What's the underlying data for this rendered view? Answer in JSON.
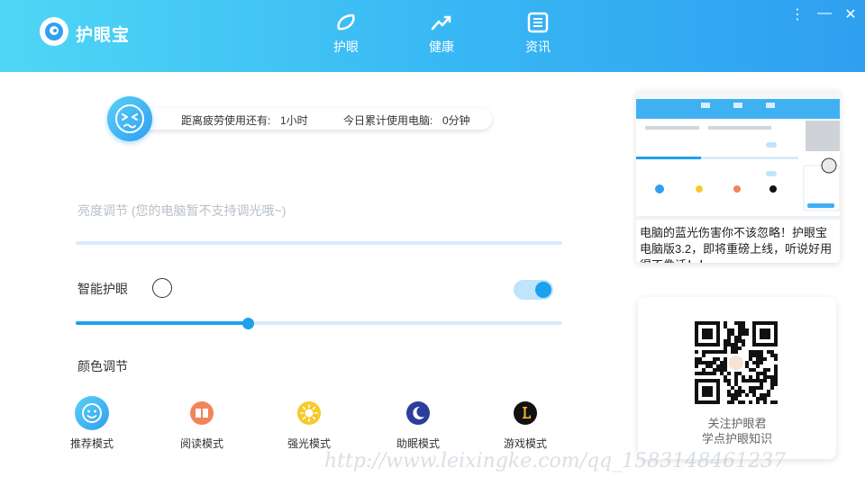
{
  "app": {
    "title": "护眼宝",
    "logo_icon": "eye-logo-icon"
  },
  "nav": [
    {
      "id": "eye",
      "label": "护眼",
      "icon": "leaf-icon"
    },
    {
      "id": "health",
      "label": "健康",
      "icon": "trend-icon"
    },
    {
      "id": "news",
      "label": "资讯",
      "icon": "document-icon"
    }
  ],
  "window_controls": {
    "menu": "⋮",
    "minimize": "—",
    "close": "✕"
  },
  "status": {
    "fatigue_label": "距离疲劳使用还有:",
    "fatigue_value": "1小时",
    "usage_label": "今日累计使用电脑:",
    "usage_value": "0分钟"
  },
  "brightness": {
    "label": "亮度调节 (您的电脑暂不支持调光哦~)",
    "level": 0
  },
  "smart_eye": {
    "label": "智能护眼",
    "toggle_on": true,
    "slider_level": 0.355
  },
  "color": {
    "label": "颜色调节"
  },
  "modes": [
    {
      "id": "recommended",
      "label": "推荐模式",
      "icon": "smile-icon"
    },
    {
      "id": "reading",
      "label": "阅读模式",
      "icon": "book-icon"
    },
    {
      "id": "bright",
      "label": "强光模式",
      "icon": "sun-icon"
    },
    {
      "id": "sleep",
      "label": "助眠模式",
      "icon": "moon-icon"
    },
    {
      "id": "game",
      "label": "游戏模式",
      "icon": "game-l-icon"
    }
  ],
  "news": {
    "text": "电脑的蓝光伤害你不该忽略！护眼宝电脑版3.2，即将重磅上线，听说好用得不像话！！ ..."
  },
  "qr": {
    "line1": "关注护眼君",
    "line2": "学点护眼知识"
  },
  "watermark": "http://www.leixingke.com/qq_1583148461237",
  "colors": {
    "accent": "#1ea0f0",
    "header_start": "#4fd6f5",
    "header_end": "#2f9ff0"
  }
}
